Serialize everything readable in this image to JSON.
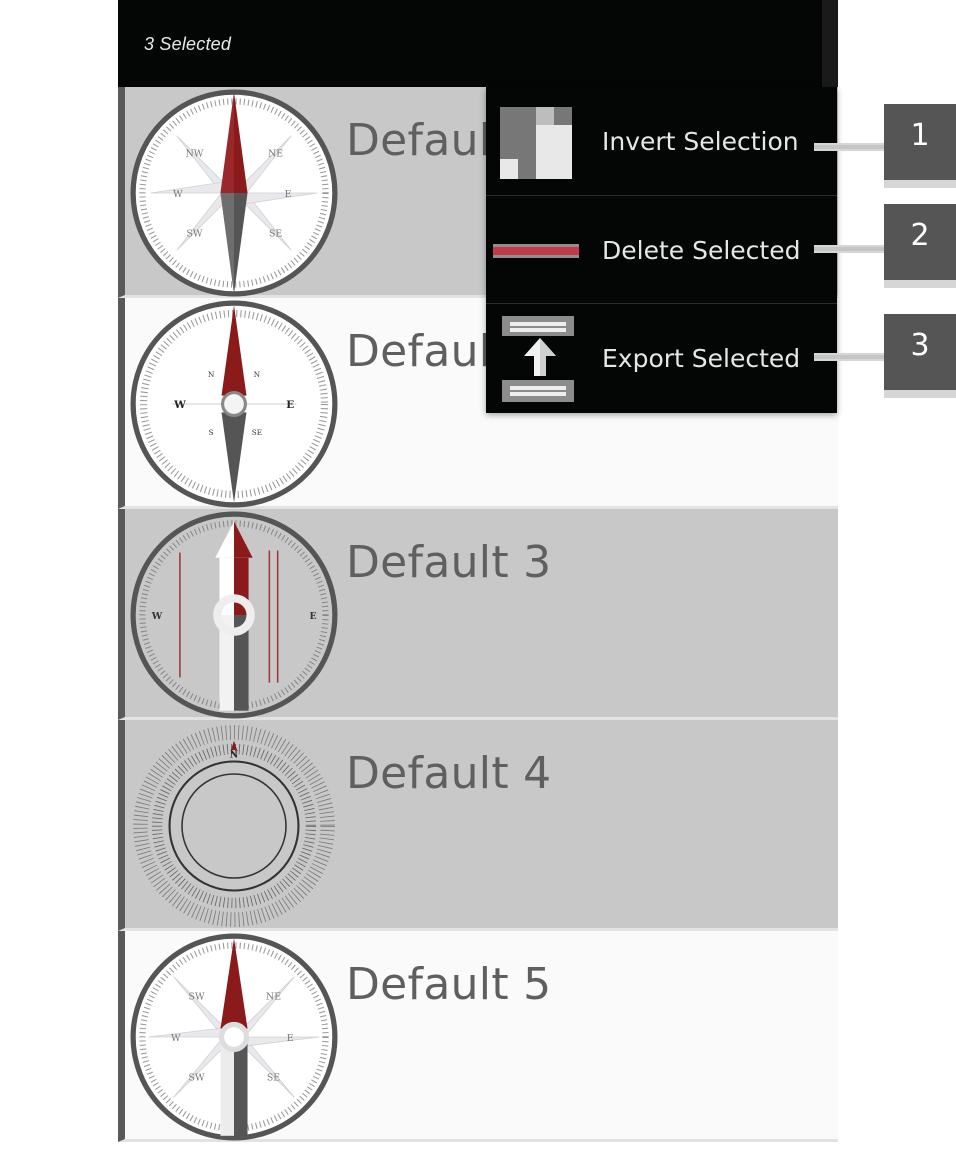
{
  "action_bar": {
    "title": "3 Selected"
  },
  "list": {
    "items": [
      {
        "label": "Default",
        "selected": true
      },
      {
        "label": "Default",
        "selected": false
      },
      {
        "label": "Default 3",
        "selected": true
      },
      {
        "label": "Default 4",
        "selected": true
      },
      {
        "label": "Default 5",
        "selected": false
      }
    ]
  },
  "menu": {
    "items": [
      {
        "label": "Invert Selection",
        "icon": "invert-selection-icon"
      },
      {
        "label": "Delete Selected",
        "icon": "delete-bar-icon"
      },
      {
        "label": "Export Selected",
        "icon": "export-upload-icon"
      }
    ]
  },
  "callouts": [
    "1",
    "2",
    "3"
  ],
  "colors": {
    "action_bar_bg": "#040606",
    "selected_row_bg": "#c8c8c8",
    "unselected_row_bg": "#fafafa",
    "needle_red": "#8b1a1a",
    "delete_red": "#c53a4a",
    "callout_gray": "#555555"
  }
}
